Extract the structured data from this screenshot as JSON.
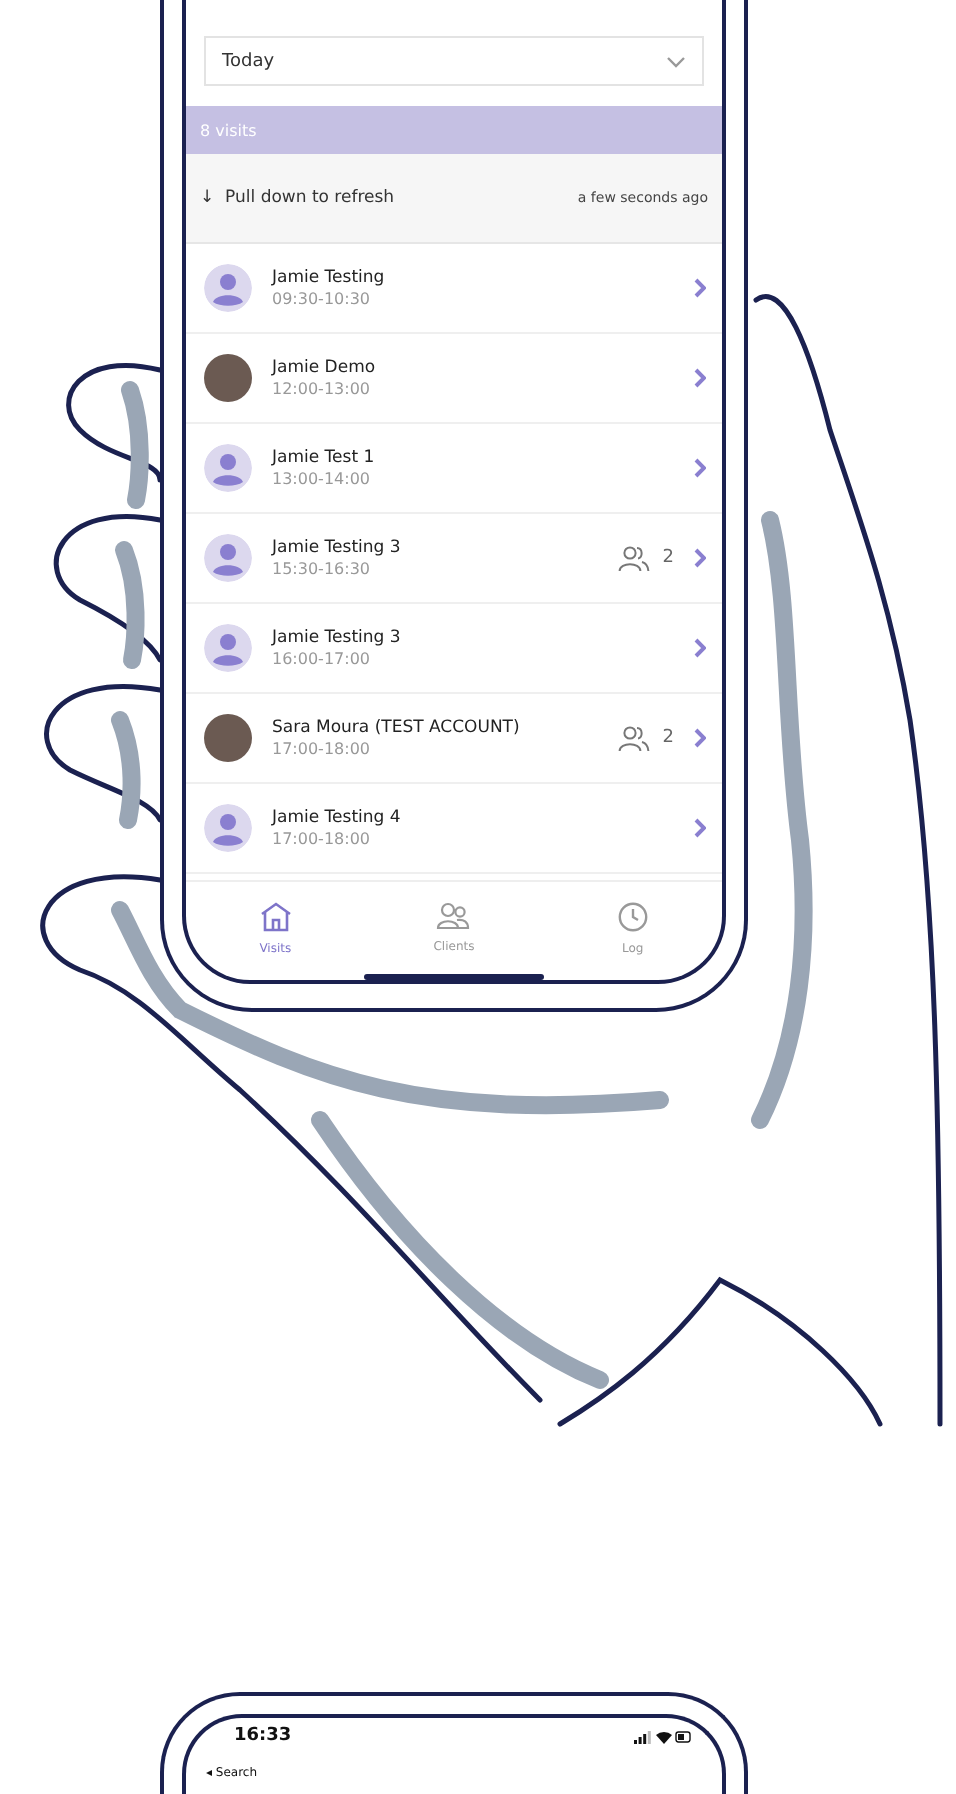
{
  "filter": {
    "value": "Today"
  },
  "summary": "8 visits",
  "refresh": {
    "icon": "↓",
    "label": "Pull down to refresh",
    "updated": "a few seconds ago"
  },
  "visits": [
    {
      "name": "Jamie Testing",
      "time": "09:30-10:30",
      "kind": "placeholder"
    },
    {
      "name": "Jamie Demo",
      "time": "12:00-13:00",
      "kind": "photo"
    },
    {
      "name": "Jamie Test 1",
      "time": "13:00-14:00",
      "kind": "placeholder"
    },
    {
      "name": "Jamie Testing 3",
      "time": "15:30-16:30",
      "kind": "placeholder",
      "guests": "2"
    },
    {
      "name": "Jamie Testing 3",
      "time": "16:00-17:00",
      "kind": "placeholder"
    },
    {
      "name": "Sara Moura (TEST ACCOUNT)",
      "time": "17:00-18:00",
      "kind": "photo",
      "guests": "2"
    },
    {
      "name": "Jamie Testing 4",
      "time": "17:00-18:00",
      "kind": "placeholder"
    }
  ],
  "tabs": [
    {
      "label": "Visits",
      "kind": "home",
      "selected": true
    },
    {
      "label": "Clients",
      "kind": "people",
      "selected": false
    },
    {
      "label": "Log",
      "kind": "clock",
      "selected": false
    }
  ],
  "second_phone": {
    "time": "16:33",
    "back": "◂ Search"
  }
}
